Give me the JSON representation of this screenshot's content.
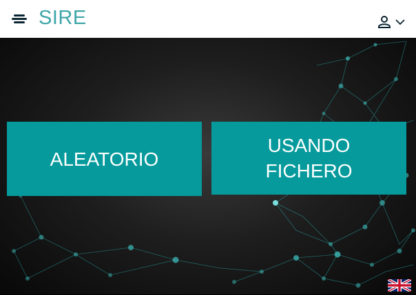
{
  "app": {
    "title": "SIRE"
  },
  "header": {
    "menu_icon": "hamburger-icon",
    "user_icon": "user-icon",
    "dropdown_icon": "chevron-down-icon"
  },
  "options": [
    {
      "lines": [
        "ALEATORIO"
      ]
    },
    {
      "lines": [
        "USANDO",
        "FICHERO"
      ]
    }
  ],
  "language": {
    "icon": "uk-flag-icon"
  },
  "colors": {
    "accent": "#069a9c",
    "title": "#3ea6a8",
    "header_bg": "#ffffff",
    "menu_icon": "#0b2431"
  }
}
